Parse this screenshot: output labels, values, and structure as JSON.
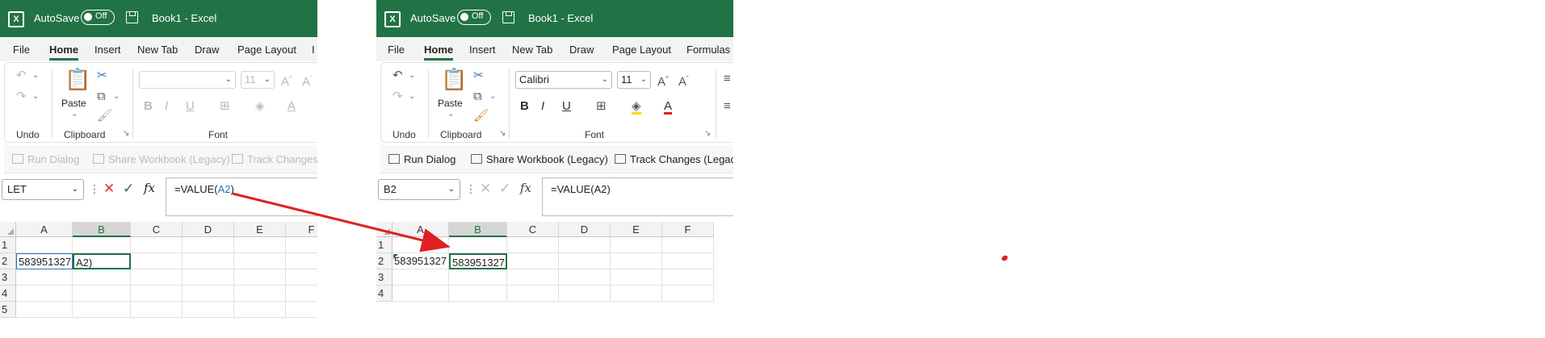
{
  "colors": {
    "excel_green": "#217346",
    "reference_blue": "#2f6fbf",
    "arrow_red": "#e02020"
  },
  "window_left": {
    "app_title": "Book1 - Excel",
    "autosave_label": "AutoSave",
    "autosave_state": "Off",
    "tabs": [
      "File",
      "Home",
      "Insert",
      "New Tab",
      "Draw",
      "Page Layout",
      "I"
    ],
    "active_tab": "Home",
    "groups": {
      "undo": "Undo",
      "clipboard": "Clipboard",
      "font": "Font",
      "paste": "Paste"
    },
    "font_name": "",
    "font_size": "11",
    "quick_commands": [
      "Run Dialog",
      "Share Workbook (Legacy)",
      "Track Changes ("
    ],
    "name_box": "LET",
    "formula_prefix": "=VALUE(",
    "formula_ref": "A2",
    "formula_suffix": ")",
    "columns": [
      "A",
      "B",
      "C",
      "D",
      "E",
      "F"
    ],
    "rows": [
      "1",
      "2",
      "3",
      "4",
      "5"
    ],
    "cell_A2": "583951327",
    "cell_B2": "A2)"
  },
  "window_right": {
    "app_title": "Book1 - Excel",
    "autosave_label": "AutoSave",
    "autosave_state": "Off",
    "tabs": [
      "File",
      "Home",
      "Insert",
      "New Tab",
      "Draw",
      "Page Layout",
      "Formulas"
    ],
    "active_tab": "Home",
    "groups": {
      "undo": "Undo",
      "clipboard": "Clipboard",
      "font": "Font",
      "paste": "Paste"
    },
    "font_name": "Calibri",
    "font_size": "11",
    "quick_commands": [
      "Run Dialog",
      "Share Workbook (Legacy)",
      "Track Changes (Legacy)"
    ],
    "name_box": "B2",
    "formula": "=VALUE(A2)",
    "columns": [
      "A",
      "B",
      "C",
      "D",
      "E",
      "F"
    ],
    "rows": [
      "1",
      "2",
      "3",
      "4"
    ],
    "cell_A2": "583951327",
    "cell_B2": "583951327"
  },
  "icons": {
    "undo": "undo-icon",
    "redo": "redo-icon",
    "cut": "cut-icon",
    "copy": "copy-icon",
    "format_painter": "format-painter-icon",
    "bold": "bold-icon",
    "italic": "italic-icon",
    "underline": "underline-icon",
    "borders": "borders-icon",
    "fill": "fill-color-icon",
    "font_color": "font-color-icon",
    "cancel": "cancel-icon",
    "enter": "enter-icon",
    "fx": "function-icon"
  }
}
